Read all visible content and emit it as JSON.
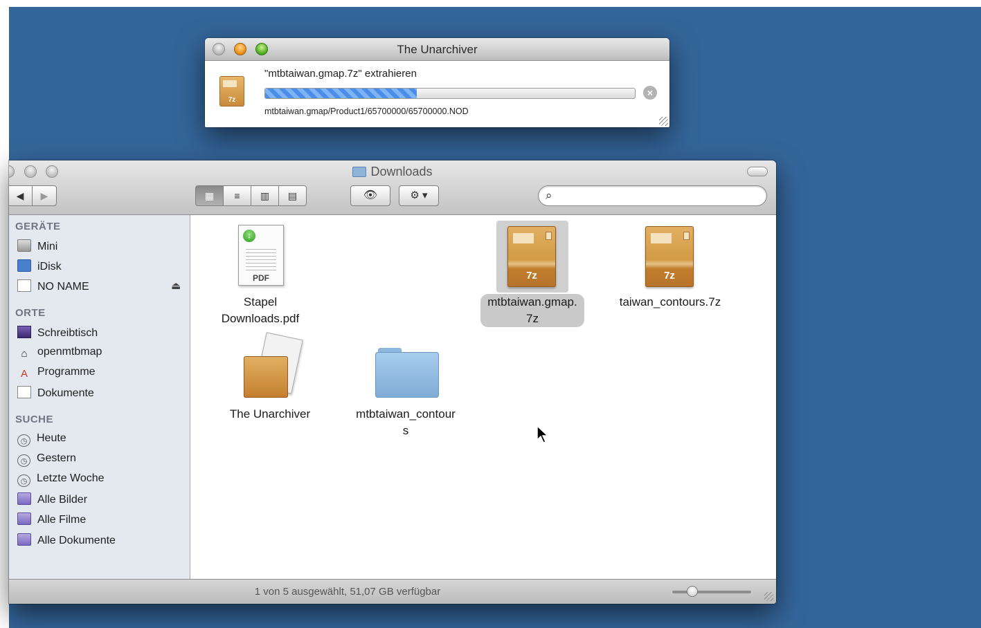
{
  "unarchiver": {
    "title": "The Unarchiver",
    "message": "\"mtbtaiwan.gmap.7z\" extrahieren",
    "progress": 0.41,
    "current_file": "mtbtaiwan.gmap/Product1/65700000/65700000.NOD",
    "archive_label": "7z",
    "cancel_icon": "cancel-x-icon"
  },
  "finder": {
    "title": "Downloads",
    "back_glyph": "◀",
    "forward_glyph": "▶",
    "view_modes": [
      {
        "name": "icon-view",
        "glyph": "▦",
        "selected": true
      },
      {
        "name": "list-view",
        "glyph": "≡",
        "selected": false
      },
      {
        "name": "column-view",
        "glyph": "▥",
        "selected": false
      },
      {
        "name": "coverflow-view",
        "glyph": "▤",
        "selected": false
      }
    ],
    "quicklook_glyph": "👁",
    "action_glyph": "⚙ ▾",
    "search": {
      "value": "",
      "placeholder": ""
    },
    "sidebar": {
      "sections": [
        {
          "heading": "GERÄTE",
          "items": [
            {
              "label": "Mini",
              "icon": "hard-disk-icon"
            },
            {
              "label": "iDisk",
              "icon": "idisk-icon"
            },
            {
              "label": "NO NAME",
              "icon": "external-disk-icon",
              "eject": "⏏"
            }
          ]
        },
        {
          "heading": "ORTE",
          "items": [
            {
              "label": "Schreibtisch",
              "icon": "desktop-icon"
            },
            {
              "label": "openmtbmap",
              "icon": "home-icon"
            },
            {
              "label": "Programme",
              "icon": "applications-icon"
            },
            {
              "label": "Dokumente",
              "icon": "documents-icon"
            }
          ]
        },
        {
          "heading": "SUCHE",
          "items": [
            {
              "label": "Heute",
              "icon": "clock-icon"
            },
            {
              "label": "Gestern",
              "icon": "clock-icon"
            },
            {
              "label": "Letzte Woche",
              "icon": "clock-icon"
            },
            {
              "label": "Alle Bilder",
              "icon": "smart-folder-icon"
            },
            {
              "label": "Alle Filme",
              "icon": "smart-folder-icon"
            },
            {
              "label": "Alle Dokumente",
              "icon": "smart-folder-icon"
            }
          ]
        }
      ]
    },
    "files": [
      {
        "name": "Stapel\nDownloads.pdf",
        "type": "pdf",
        "label": "PDF",
        "selected": false
      },
      {
        "name": "mtbtaiwan.gmap.\n7z",
        "type": "7z",
        "label": "7z",
        "selected": true
      },
      {
        "name": "taiwan_contours.7z",
        "type": "7z",
        "label": "7z",
        "selected": false
      },
      {
        "name": "The Unarchiver",
        "type": "app",
        "selected": false
      },
      {
        "name": "mtbtaiwan_contour\ns",
        "type": "folder",
        "selected": false
      }
    ],
    "status": "1 von 5 ausgewählt, 51,07 GB verfügbar",
    "icon_size": 0.25
  }
}
